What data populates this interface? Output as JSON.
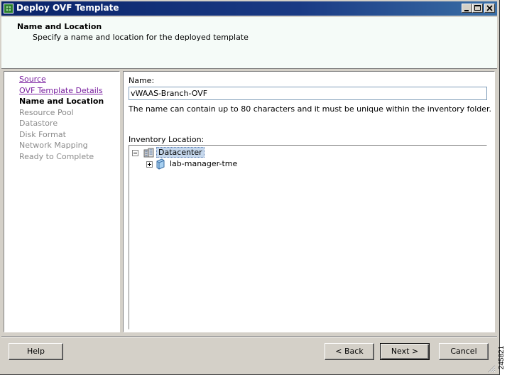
{
  "window": {
    "title": "Deploy OVF Template"
  },
  "header": {
    "title": "Name and Location",
    "subtitle": "Specify a name and location for the deployed template"
  },
  "steps": [
    {
      "label": "Source",
      "state": "done"
    },
    {
      "label": "OVF Template Details",
      "state": "done"
    },
    {
      "label": "Name and Location",
      "state": "current"
    },
    {
      "label": "Resource Pool",
      "state": "pending"
    },
    {
      "label": "Datastore",
      "state": "pending"
    },
    {
      "label": "Disk Format",
      "state": "pending"
    },
    {
      "label": "Network Mapping",
      "state": "pending"
    },
    {
      "label": "Ready to Complete",
      "state": "pending"
    }
  ],
  "form": {
    "name_label": "Name:",
    "name_value": "vWAAS-Branch-OVF",
    "hint": "The name can contain up to 80 characters and it must be unique within the inventory folder.",
    "inventory_label": "Inventory Location:"
  },
  "tree": [
    {
      "label": "Datacenter",
      "icon": "datacenter-icon",
      "expanded": true,
      "selected": true
    },
    {
      "label": "lab-manager-tme",
      "icon": "folder-icon",
      "expanded": false,
      "selected": false
    }
  ],
  "buttons": {
    "help": "Help",
    "back": "< Back",
    "next": "Next >",
    "cancel": "Cancel"
  },
  "figure_id": "245821",
  "colors": {
    "titlebar": "#0a246a",
    "link": "#7a1fa0",
    "selection": "#c5d7ec"
  }
}
